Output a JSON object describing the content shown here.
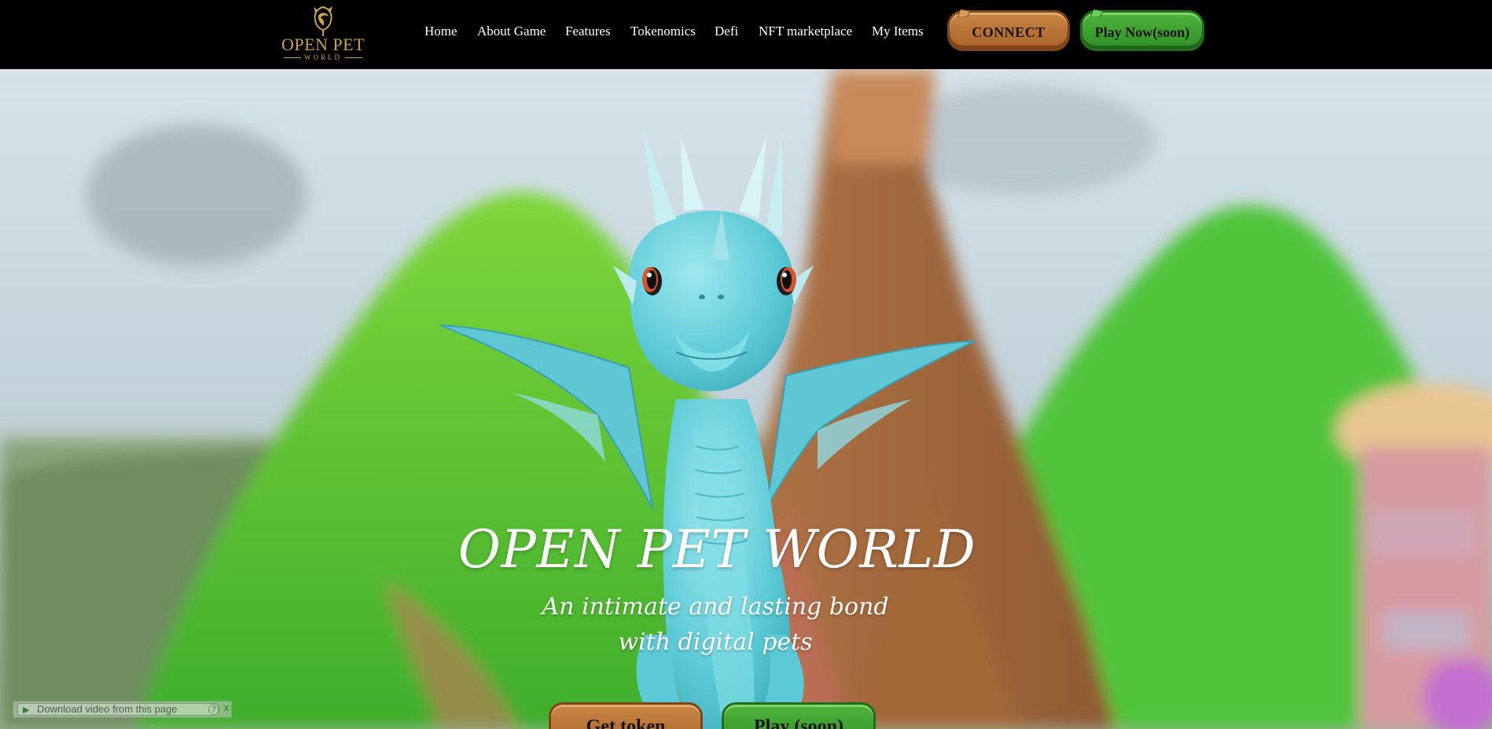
{
  "nav": {
    "logo": {
      "main": "OPEN PET",
      "sub": "WORLD"
    },
    "links": [
      "Home",
      "About Game",
      "Features",
      "Tokenomics",
      "Defi",
      "NFT marketplace",
      "My Items"
    ],
    "connect_label": "CONNECT",
    "play_label": "Play Now(soon)"
  },
  "hero": {
    "title": "OPEN PET WORLD",
    "subtitle_line1": "An intimate and lasting bond",
    "subtitle_line2": "with digital pets",
    "get_token_label": "Get token",
    "play_label": "Play (soon)"
  },
  "download_bar": {
    "label": "Download video from this page",
    "help": "?",
    "close": "X"
  },
  "colors": {
    "nav_bg": "#000000",
    "logo_gold": "#c9a250",
    "button_orange": "#b8733a",
    "button_green": "#3fa332",
    "hero_text": "#ffffff"
  }
}
